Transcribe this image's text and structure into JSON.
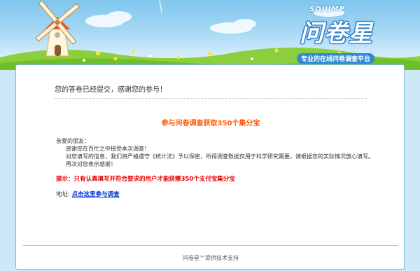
{
  "header": {
    "logo_en": "SOJUMP",
    "logo_cn": "问卷星",
    "slogan": "专业的在线问卷调查平台"
  },
  "main": {
    "thanks_text": "您的答卷已经提交，感谢您的参与！",
    "promo_title": "参与问卷调查获取350个集分宝",
    "letter": {
      "greeting": "亲爱的朋友：",
      "line1": "感谢您在百忙之中接受本次调查！",
      "line2": "对您填写的信息，我们将严格遵守《统计法》予以保密，所得调查数据仅用于科学研究需要。请根据您的实际情况放心填写。",
      "line3": "再次对您表示感谢！"
    },
    "tip": "提示：只有认真填写并符合要求的用户才能获赠350个支付宝集分宝",
    "address_label": "地址:",
    "address_link": "点击这里参与调查"
  },
  "footer": {
    "text": "问卷星™提供技术支持"
  }
}
